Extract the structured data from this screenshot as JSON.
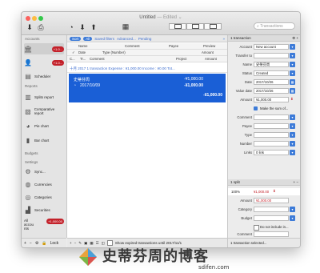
{
  "window": {
    "title": "Untitled",
    "title_suffix": "— Edited ⌄"
  },
  "toolbar": {
    "search_placeholder": "Transactions"
  },
  "sidebar": {
    "section_accounts": "Accounts",
    "accounts": [
      {
        "label": "",
        "badge": "+1.0...",
        "icon": "bank-icon"
      },
      {
        "label": "",
        "badge": "+1.0...",
        "icon": "person-icon"
      }
    ],
    "items": [
      {
        "label": "Scheduler",
        "icon": "calendar-icon"
      }
    ],
    "section_reports": "Reports",
    "reports": [
      {
        "label": "Splits report",
        "icon": "report-icon"
      },
      {
        "label": "Comparative report",
        "icon": "compare-icon"
      },
      {
        "label": "Pie chart",
        "icon": "pie-chart-icon"
      },
      {
        "label": "Bar chart",
        "icon": "bar-chart-icon"
      }
    ],
    "section_budgets": "Budgets",
    "section_settings": "Settings",
    "settings": [
      {
        "label": "Sync...",
        "icon": "sync-icon"
      },
      {
        "label": "Currencies",
        "icon": "currency-icon"
      },
      {
        "label": "Categories",
        "icon": "categories-icon"
      },
      {
        "label": "Securities",
        "icon": "securities-icon"
      }
    ],
    "all_accounts": "All accou nts",
    "all_badge": "+1,000.00",
    "bottom_lock": "Lock"
  },
  "filterbar": {
    "sort": "Sort",
    "all": "All",
    "saved": "Saved filters",
    "advanced": "Advanced...",
    "pending": "Pending"
  },
  "columns": {
    "row1": [
      "Name",
      "Comment",
      "Payee",
      "Preview"
    ],
    "row2": [
      "Date",
      "Type (Number)",
      "Amount"
    ],
    "row3": [
      "C...",
      "Tr...",
      "Comment",
      "Project",
      "Amount"
    ]
  },
  "group": {
    "label": "十月 2017   1 transaction   Expense : ¥1,000.00   Income : ¥0.00   Tot..."
  },
  "transaction": {
    "name": "史蒂芬周",
    "date": "2017/10/09",
    "amount": "-¥1,000.00",
    "amount2": "-¥1,000.00",
    "balance": "-¥1,000.00"
  },
  "main_status": "Show expired transactions until 2017/11/1",
  "inspector": {
    "header": "1 transaction",
    "fields": [
      {
        "label": "Account",
        "value": "New account"
      },
      {
        "label": "Transfer to",
        "value": ""
      },
      {
        "label": "Name",
        "value": "史蒂芬周"
      },
      {
        "label": "Status",
        "value": "Created"
      },
      {
        "label": "Date",
        "value": "2017/10/26"
      },
      {
        "label": "Value date",
        "value": "2017/10/26"
      },
      {
        "label": "Amount",
        "value": "¥1,000.00"
      }
    ],
    "make_sum": "Make the sum of...",
    "fields2": [
      {
        "label": "Comment",
        "value": ""
      },
      {
        "label": "Payee",
        "value": ""
      },
      {
        "label": "Type",
        "value": ""
      },
      {
        "label": "Number",
        "value": ""
      },
      {
        "label": "Links",
        "value": "0 link"
      }
    ],
    "split_header": "1 split",
    "split_pct": "100%",
    "split_amount": "¥1,000.00",
    "fields3": [
      {
        "label": "Category",
        "value": ""
      },
      {
        "label": "Budget",
        "value": ""
      }
    ],
    "not_included": "Do not include in...",
    "comment_label": "Comment",
    "status": "1 transaction selected..."
  },
  "watermark": {
    "text": "史蒂芬周的博客",
    "url": "sdifen.com"
  },
  "colors": {
    "accent": "#1a5fd6",
    "badge": "#c3212a",
    "link": "#3f6fd0"
  }
}
